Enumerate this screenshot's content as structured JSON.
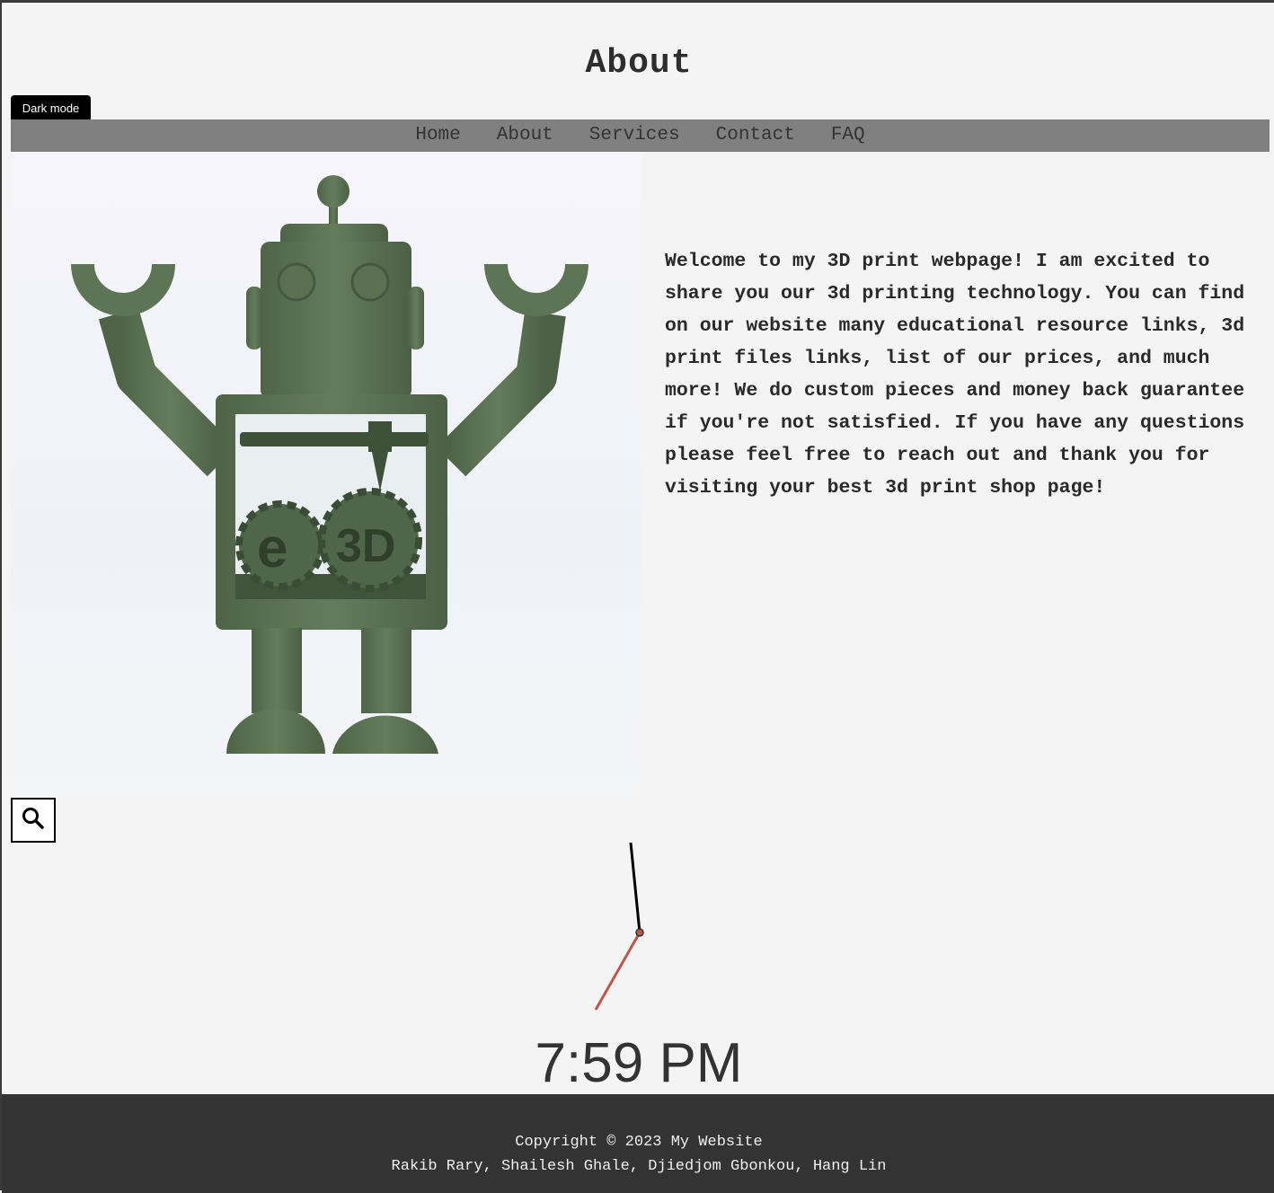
{
  "header": {
    "title": "About",
    "dark_mode_label": "Dark mode"
  },
  "nav": {
    "items": [
      "Home",
      "About",
      "Services",
      "Contact",
      "FAQ"
    ]
  },
  "main": {
    "image_logo_text": "e3D",
    "intro": "Welcome to my 3D print webpage! I am excited to share you our 3d printing technology. You can find on our website many educational resource links, 3d print files links, list of our prices, and much more! We do custom pieces and money back guarantee if you're not satisfied. If you have any questions please feel free to reach out and thank you for visiting your best 3d print shop page!"
  },
  "search": {
    "icon": "search-icon"
  },
  "clock": {
    "time": "7:59 PM",
    "colors": {
      "hour_hand": "#c0574a",
      "minute_hand": "#000000"
    }
  },
  "footer": {
    "copyright": "Copyright © 2023 My Website",
    "authors": "Rakib Rary, Shailesh Ghale, Djiedjom Gbonkou, Hang Lin"
  }
}
